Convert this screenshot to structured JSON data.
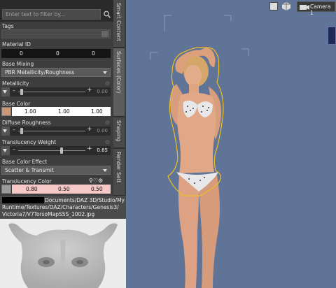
{
  "filter": {
    "placeholder": "Enter text to filter by..."
  },
  "properties": {
    "tags_label": "Tags",
    "material_id": {
      "label": "Material ID",
      "values": [
        "0",
        "0",
        "0"
      ]
    },
    "base_mixing": {
      "label": "Base Mixing",
      "value": "PBR Metallicity/Roughness"
    },
    "metallicity": {
      "label": "Metallicity",
      "value": "0.00"
    },
    "base_color": {
      "label": "Base Color",
      "values": [
        "1.00",
        "1.00",
        "1.00"
      ],
      "swatch": "#ffffff"
    },
    "diffuse_roughness": {
      "label": "Diffuse Roughness",
      "value": "0.00"
    },
    "translucency_weight": {
      "label": "Translucency Weight",
      "value": "0.65",
      "level": 0.65
    },
    "base_color_effect": {
      "label": "Base Color Effect",
      "value": "Scatter & Transmit"
    },
    "translucency_color": {
      "label": "Translucency Color",
      "values": [
        "0.80",
        "0.50",
        "0.50"
      ],
      "swatch": "#f6c8c8"
    }
  },
  "tabs": [
    "Smart Content",
    "Surfaces (Color)",
    "Shaping",
    "Render Sett"
  ],
  "image_path": {
    "lines": [
      "Documents/DAZ 3D/Studio/My Library/",
      "Runtime/Textures/DAZ/Characters/Genesis3/",
      "Victoria7/V7TorsoMapSSS_1002.jpg"
    ]
  },
  "viewport": {
    "camera_label": "Camera 1"
  },
  "colors": {
    "viewport_bg": "#5f7497",
    "selection_outline": "#f0c020",
    "panel_bg": "#3d3d3d"
  }
}
